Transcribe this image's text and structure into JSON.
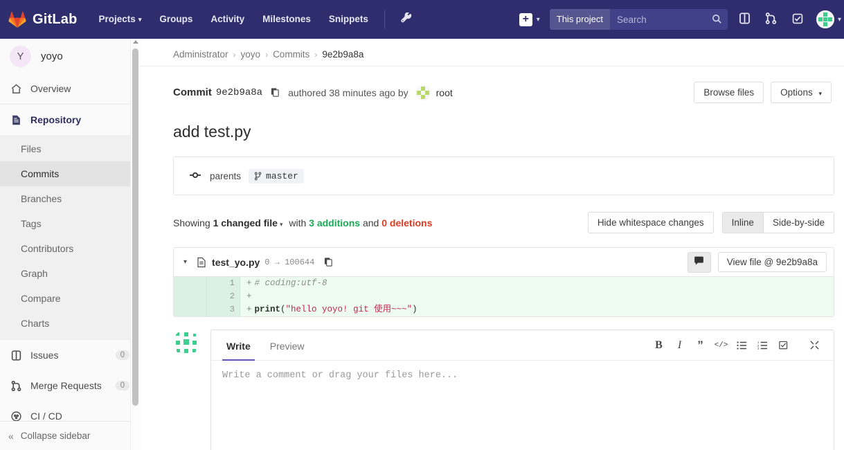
{
  "navbar": {
    "brand": "GitLab",
    "logo_icon": "gitlab-fox-icon",
    "links": [
      {
        "label": "Projects",
        "caret": "▾",
        "name": "nav-projects"
      },
      {
        "label": "Groups",
        "caret": "",
        "name": "nav-groups"
      },
      {
        "label": "Activity",
        "caret": "",
        "name": "nav-activity"
      },
      {
        "label": "Milestones",
        "caret": "",
        "name": "nav-milestones"
      },
      {
        "label": "Snippets",
        "caret": "",
        "name": "nav-snippets"
      }
    ],
    "wrench_icon": "wrench-icon",
    "plus_label": "+",
    "plus_caret": "▾",
    "search_scope": "This project",
    "search_placeholder": "Search",
    "search_value": "",
    "icons": [
      "issues-icon",
      "merge-requests-icon",
      "todos-icon"
    ],
    "avatar_caret": "▾",
    "bg_color": "#2e2e6e"
  },
  "sidebar": {
    "project_initial": "Y",
    "project_name": "yoyo",
    "items": [
      {
        "label": "Overview",
        "icon": "home-icon",
        "name": "sidebar-item-overview"
      },
      {
        "label": "Repository",
        "icon": "repository-icon",
        "name": "sidebar-item-repository"
      }
    ],
    "sub_items": [
      {
        "label": "Files",
        "name": "sidebar-subitem-files"
      },
      {
        "label": "Commits",
        "name": "sidebar-subitem-commits"
      },
      {
        "label": "Branches",
        "name": "sidebar-subitem-branches"
      },
      {
        "label": "Tags",
        "name": "sidebar-subitem-tags"
      },
      {
        "label": "Contributors",
        "name": "sidebar-subitem-contributors"
      },
      {
        "label": "Graph",
        "name": "sidebar-subitem-graph"
      },
      {
        "label": "Compare",
        "name": "sidebar-subitem-compare"
      },
      {
        "label": "Charts",
        "name": "sidebar-subitem-charts"
      }
    ],
    "bottom_items": [
      {
        "label": "Issues",
        "badge": "0",
        "icon": "issues-icon",
        "name": "sidebar-item-issues"
      },
      {
        "label": "Merge Requests",
        "badge": "0",
        "icon": "merge-requests-icon",
        "name": "sidebar-item-merge-requests"
      },
      {
        "label": "CI / CD",
        "badge": "",
        "icon": "ci-cd-icon",
        "name": "sidebar-item-ci-cd"
      }
    ],
    "collapse_label": "Collapse sidebar",
    "collapse_icon": "double-chevron-left-icon"
  },
  "breadcrumb": {
    "items": [
      "Administrator",
      "yoyo",
      "Commits",
      "9e2b9a8a"
    ],
    "separator": "›"
  },
  "commit": {
    "label": "Commit",
    "sha": "9e2b9a8a",
    "copy_icon": "copy-icon",
    "authored_text": "authored 38 minutes ago by",
    "author": "root",
    "browse_files_label": "Browse files",
    "options_label": "Options",
    "options_caret": "▾",
    "title": "add test.py",
    "parents_label": "parents",
    "parents_icon": "commit-node-icon",
    "branch_icon": "⑂",
    "branch_name": "master"
  },
  "diff_summary": {
    "showing": "Showing",
    "changed_file": "1 changed file",
    "caret": "▾",
    "with": "with",
    "additions": "3 additions",
    "and": "and",
    "deletions": "0 deletions",
    "hide_whitespace_label": "Hide whitespace changes",
    "inline_label": "Inline",
    "side_by_side_label": "Side-by-side",
    "additions_color": "#1aaa55",
    "deletions_color": "#db3b21"
  },
  "file": {
    "chevron": "▾",
    "file_icon": "file-icon",
    "name": "test_yo.py",
    "mode": "0 → 100644",
    "copy_icon": "copy-icon",
    "comment_icon": "comment-bubble-icon",
    "view_file_label": "View file @ 9e2b9a8a",
    "lines": [
      {
        "old": "",
        "new": "1",
        "sign": "+",
        "type": "comment",
        "text": "# coding:utf-8"
      },
      {
        "old": "",
        "new": "2",
        "sign": "+",
        "type": "blank",
        "text": ""
      },
      {
        "old": "",
        "new": "3",
        "sign": "+",
        "type": "code",
        "keyword": "print",
        "open": "(",
        "string": "\"hello yoyo! git 使用~~~\"",
        "close": ")"
      }
    ]
  },
  "comment_form": {
    "avatar_icon": "identicon-avatar",
    "tabs": [
      {
        "label": "Write",
        "name": "tab-write"
      },
      {
        "label": "Preview",
        "name": "tab-preview"
      }
    ],
    "toolbar": [
      {
        "glyph": "B",
        "name": "bold-icon"
      },
      {
        "glyph": "I",
        "name": "italic-icon"
      },
      {
        "glyph": "”",
        "name": "quote-icon"
      },
      {
        "glyph": "</>",
        "name": "code-icon"
      },
      {
        "glyph": "≡",
        "name": "bullet-list-icon"
      },
      {
        "glyph": "☰",
        "name": "numbered-list-icon"
      },
      {
        "glyph": "☑",
        "name": "task-list-icon"
      },
      {
        "glyph": "⤢",
        "name": "fullscreen-icon"
      }
    ],
    "placeholder": "Write a comment or drag your files here...",
    "value": "",
    "active_tab_color": "#6b4fbb"
  }
}
